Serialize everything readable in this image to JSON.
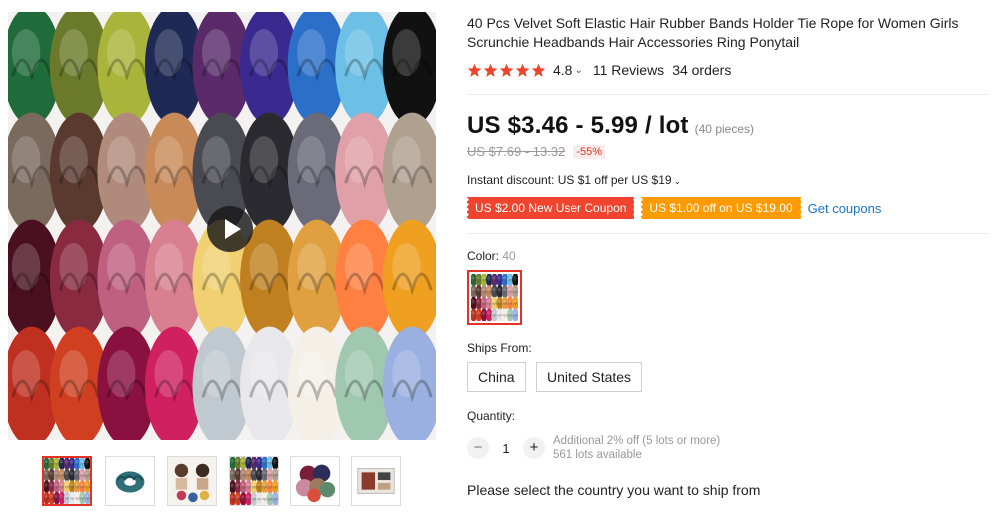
{
  "product": {
    "title": "40 Pcs Velvet Soft Elastic Hair Rubber Bands Holder Tie Rope for Women Girls Scrunchie Headbands Hair Accessories Ring Ponytail",
    "rating_value": "4.8",
    "rating_caret": "⌄",
    "reviews_text": "11 Reviews",
    "orders_text": "34 orders",
    "star_color": "#f0432f"
  },
  "pricing": {
    "price": "US $3.46 - 5.99 / lot",
    "pieces": "(40 pieces)",
    "original_price": "US $7.69 - 13.32",
    "discount": "-55%",
    "instant_discount": "Instant discount: US $1 off per US $19",
    "instant_caret": "⌄"
  },
  "coupons": {
    "new_user": "US $2.00 New User Coupon",
    "store": "US $1.00 off on US $19.00",
    "get_coupons": "Get coupons"
  },
  "color": {
    "label": "Color:",
    "selected_value": "40"
  },
  "shipping": {
    "label": "Ships From:",
    "options": [
      "China",
      "United States"
    ]
  },
  "quantity": {
    "label": "Quantity:",
    "minus": "−",
    "value": "1",
    "plus": "+",
    "additional": "Additional 2% off (5 lots or more)",
    "available": "561 lots available"
  },
  "ship_prompt": "Please select the country you want to ship from",
  "gallery": {
    "thumbnail_count": 6,
    "selected_thumbnail": 1
  },
  "colors": {
    "accent_red": "#e43225",
    "coupon_red": "#f0442e",
    "coupon_orange": "#ff9a00",
    "link_blue": "#1a73c8"
  }
}
